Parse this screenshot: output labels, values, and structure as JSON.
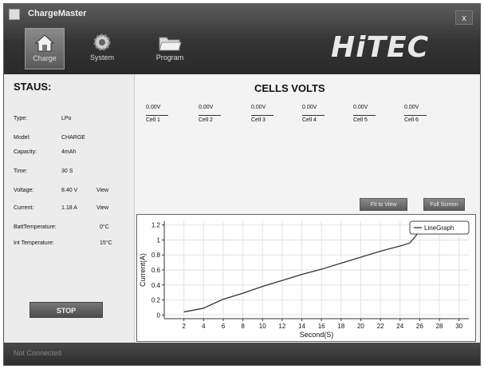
{
  "window": {
    "title": "ChargeMaster",
    "close_label": "x"
  },
  "nav": [
    {
      "label": "Charge",
      "icon": "home-icon"
    },
    {
      "label": "System",
      "icon": "gear-icon"
    },
    {
      "label": "Program",
      "icon": "folder-icon"
    }
  ],
  "logo": {
    "text": "HiTEC"
  },
  "status": {
    "title": "STAUS:",
    "rows": [
      {
        "label": "Type:",
        "value": "LPo"
      },
      {
        "label": "Model:",
        "value": "CHARGE"
      },
      {
        "label": "Capacity:",
        "value": "4mAh"
      },
      {
        "label": "Time:",
        "value": "30 S"
      },
      {
        "label": "Voltage:",
        "value": "8.40 V",
        "view": "View"
      },
      {
        "label": "Current:",
        "value": "1.18 A",
        "view": "View"
      },
      {
        "label": "BattTemperature:",
        "value": "0°C"
      },
      {
        "label": "Int Temperature:",
        "value": "15°C"
      }
    ],
    "stop_label": "STOP"
  },
  "cells": {
    "title": "CELLS VOLTS",
    "items": [
      {
        "value": "0.00V",
        "name": "Cell 1"
      },
      {
        "value": "0.00V",
        "name": "Cell 2"
      },
      {
        "value": "0.00V",
        "name": "Cell 3"
      },
      {
        "value": "0.00V",
        "name": "Cell 4"
      },
      {
        "value": "0.00V",
        "name": "Cell 5"
      },
      {
        "value": "0.00V",
        "name": "Cell 6"
      }
    ]
  },
  "graph_buttons": {
    "fit": "Fit to View",
    "full": "Full Screen"
  },
  "statusbar": {
    "text": "Not Connected"
  },
  "chart_data": {
    "type": "line",
    "xlabel": "Second(S)",
    "ylabel": "Current(A)",
    "xlim": [
      0,
      31
    ],
    "ylim": [
      -0.05,
      1.25
    ],
    "xticks": [
      2,
      4,
      6,
      8,
      10,
      12,
      14,
      16,
      18,
      20,
      22,
      24,
      26,
      28,
      30
    ],
    "yticks": [
      0,
      0.2,
      0.4,
      0.6,
      0.8,
      1,
      1.2
    ],
    "grid": true,
    "legend": "top-right",
    "series": [
      {
        "name": "LineGraph",
        "x": [
          2,
          4,
          6,
          8,
          10,
          12,
          14,
          16,
          18,
          20,
          22,
          24,
          25,
          26,
          28,
          30
        ],
        "y": [
          0.04,
          0.09,
          0.21,
          0.29,
          0.38,
          0.46,
          0.54,
          0.61,
          0.69,
          0.77,
          0.85,
          0.92,
          0.96,
          1.12,
          1.14,
          1.18
        ]
      }
    ]
  }
}
